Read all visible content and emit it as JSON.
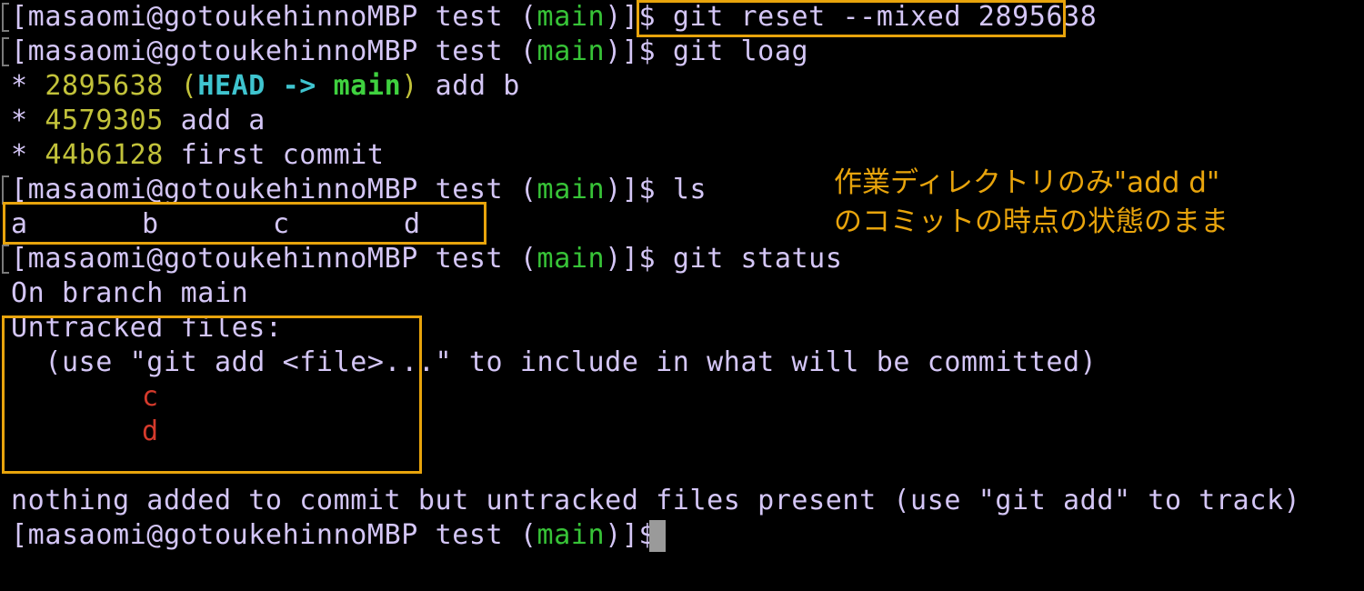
{
  "prompt": {
    "user_host": "masaomi@gotoukehinnoMBP",
    "dir": "test",
    "branch": "main",
    "suffix": "$"
  },
  "commands": {
    "reset": "git reset --mixed 2895638",
    "log": "git loag",
    "ls": "ls",
    "status": "git status"
  },
  "log": [
    {
      "hash": "2895638",
      "head": "HEAD",
      "arrow": "->",
      "branch": "main",
      "message": "add b"
    },
    {
      "hash": "4579305",
      "message": "add a"
    },
    {
      "hash": "44b6128",
      "message": "first commit"
    }
  ],
  "ls_output": [
    "a",
    "b",
    "c",
    "d"
  ],
  "status": {
    "on_branch": "On branch main",
    "untracked_header": "Untracked files:",
    "hint": "  (use \"git add <file>...\" to include in what will be committed)",
    "files": [
      "c",
      "d"
    ],
    "summary": "nothing added to commit but untracked files present (use \"git add\" to track)"
  },
  "annotation": {
    "line1": "作業ディレクトリのみ\"add d\"",
    "line2": "のコミットの時点の状態のまま"
  },
  "colors": {
    "background": "#000000",
    "prompt_text": "#d4c6f6",
    "branch": "#37c337",
    "hash": "#c2c23a",
    "head": "#3fc4cf",
    "untracked": "#d53a2c",
    "highlight": "#e8a40c"
  }
}
